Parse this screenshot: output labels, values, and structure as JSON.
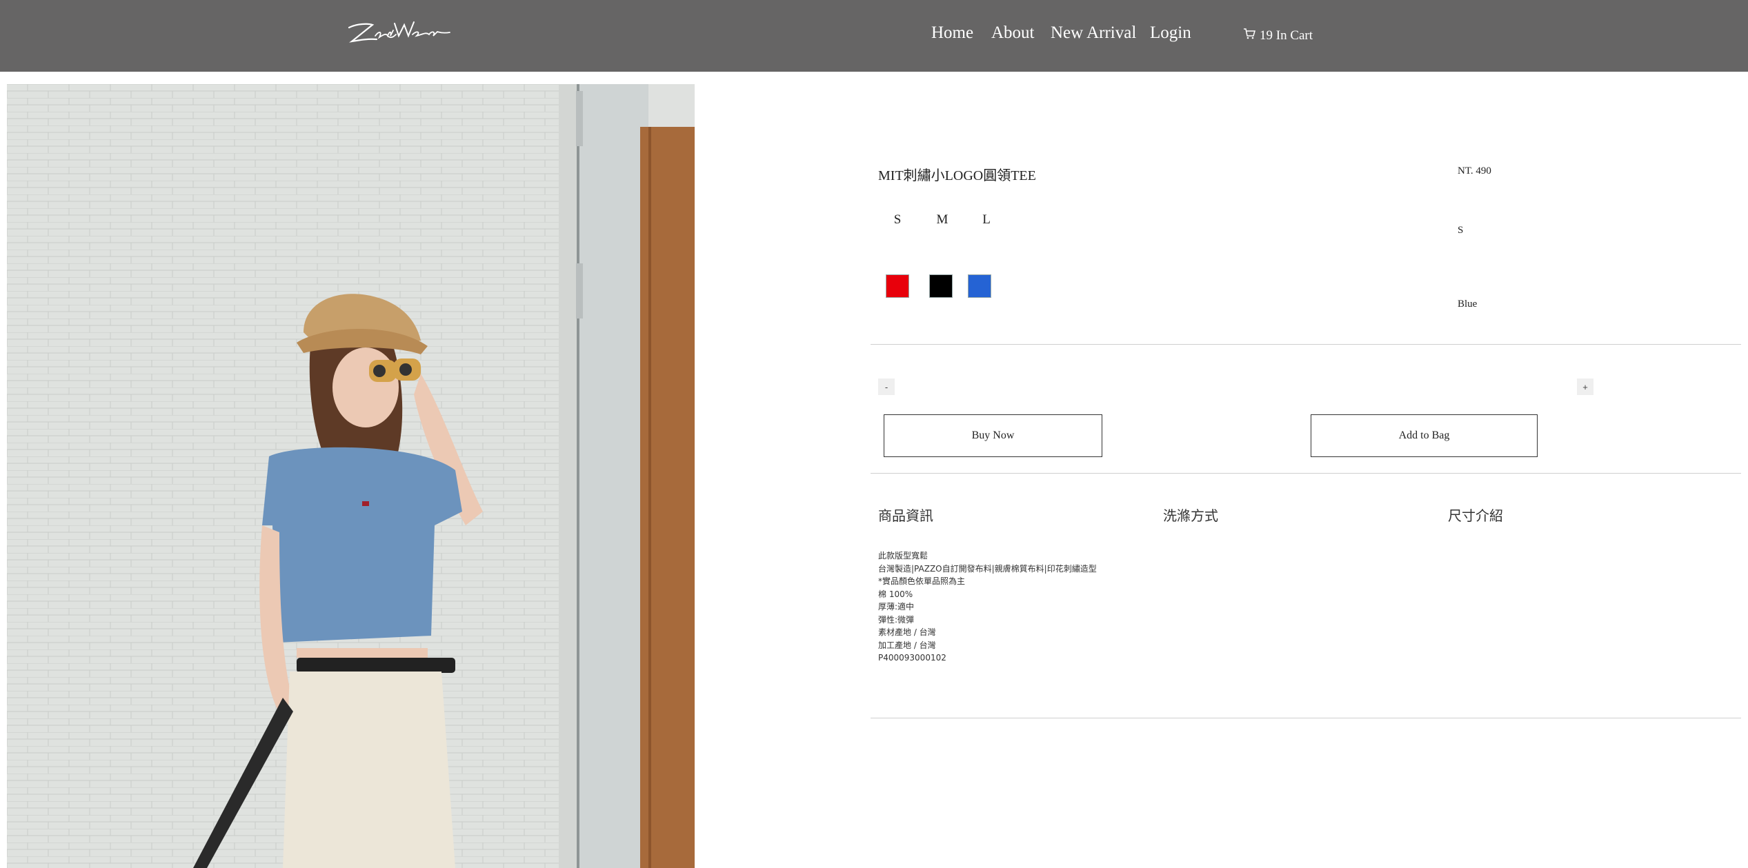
{
  "header": {
    "logo_text": "ZentWear",
    "nav": [
      {
        "label": "Home"
      },
      {
        "label": "About"
      },
      {
        "label": "New Arrival"
      },
      {
        "label": "Login"
      }
    ],
    "cart": {
      "icon": "cart-icon",
      "label": "19 In Cart"
    }
  },
  "colors": {
    "header_bg": "#666565",
    "swatch_red": "#e8000b",
    "swatch_black": "#000000",
    "swatch_blue": "#2563d4"
  },
  "product": {
    "title": "MIT刺繡小LOGO圓領TEE",
    "price": "NT. 490",
    "sizes": [
      "S",
      "M",
      "L"
    ],
    "selected_size": "S",
    "colors": [
      {
        "name": "red",
        "hex": "#e8000b"
      },
      {
        "name": "black",
        "hex": "#000000"
      },
      {
        "name": "blue",
        "hex": "#2563d4"
      }
    ],
    "selected_color": "Blue",
    "qty_minus": "-",
    "qty_plus": "+",
    "buy_now": "Buy Now",
    "add_to_bag": "Add to Bag"
  },
  "tabs": [
    {
      "label": "商品資訊"
    },
    {
      "label": "洗滌方式"
    },
    {
      "label": "尺寸介紹"
    }
  ],
  "description": [
    "此款版型寬鬆",
    "台灣製造|PAZZO自訂開發布料|親膚棉質布料|印花刺繡造型",
    "*實品顏色依單品照為主",
    "棉 100%",
    "厚薄:適中",
    "彈性:微彈",
    "素材產地 / 台灣",
    "加工產地 / 台灣",
    "P400093000102"
  ]
}
